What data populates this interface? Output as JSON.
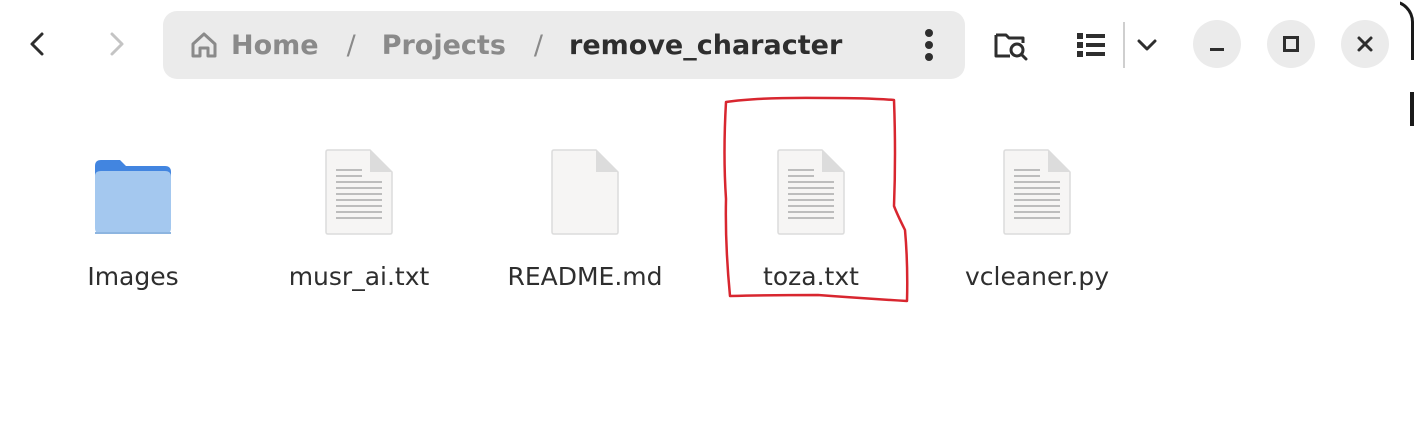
{
  "header": {
    "back_icon": "chevron-left-icon",
    "forward_icon": "chevron-right-icon",
    "breadcrumb": [
      {
        "label": "Home",
        "icon": "home-icon"
      },
      {
        "label": "Projects"
      },
      {
        "label": "remove_character",
        "current": true
      }
    ],
    "separator": "/",
    "path_menu_icon": "vertical-dots-icon",
    "search_icon": "folder-search-icon",
    "view_icon": "list-view-icon",
    "view_dropdown_icon": "chevron-down-icon",
    "window_controls": [
      "minimize-icon",
      "maximize-icon",
      "close-icon"
    ]
  },
  "files": [
    {
      "name": "Images",
      "type": "folder"
    },
    {
      "name": "musr_ai.txt",
      "type": "text"
    },
    {
      "name": "README.md",
      "type": "blank"
    },
    {
      "name": "toza.txt",
      "type": "text",
      "highlighted": true
    },
    {
      "name": "vcleaner.py",
      "type": "text"
    }
  ],
  "colors": {
    "folder_front": "#a4c8ef",
    "folder_back": "#4285e0",
    "highlight": "#d8262f",
    "pathbar_bg": "#ebebeb"
  }
}
